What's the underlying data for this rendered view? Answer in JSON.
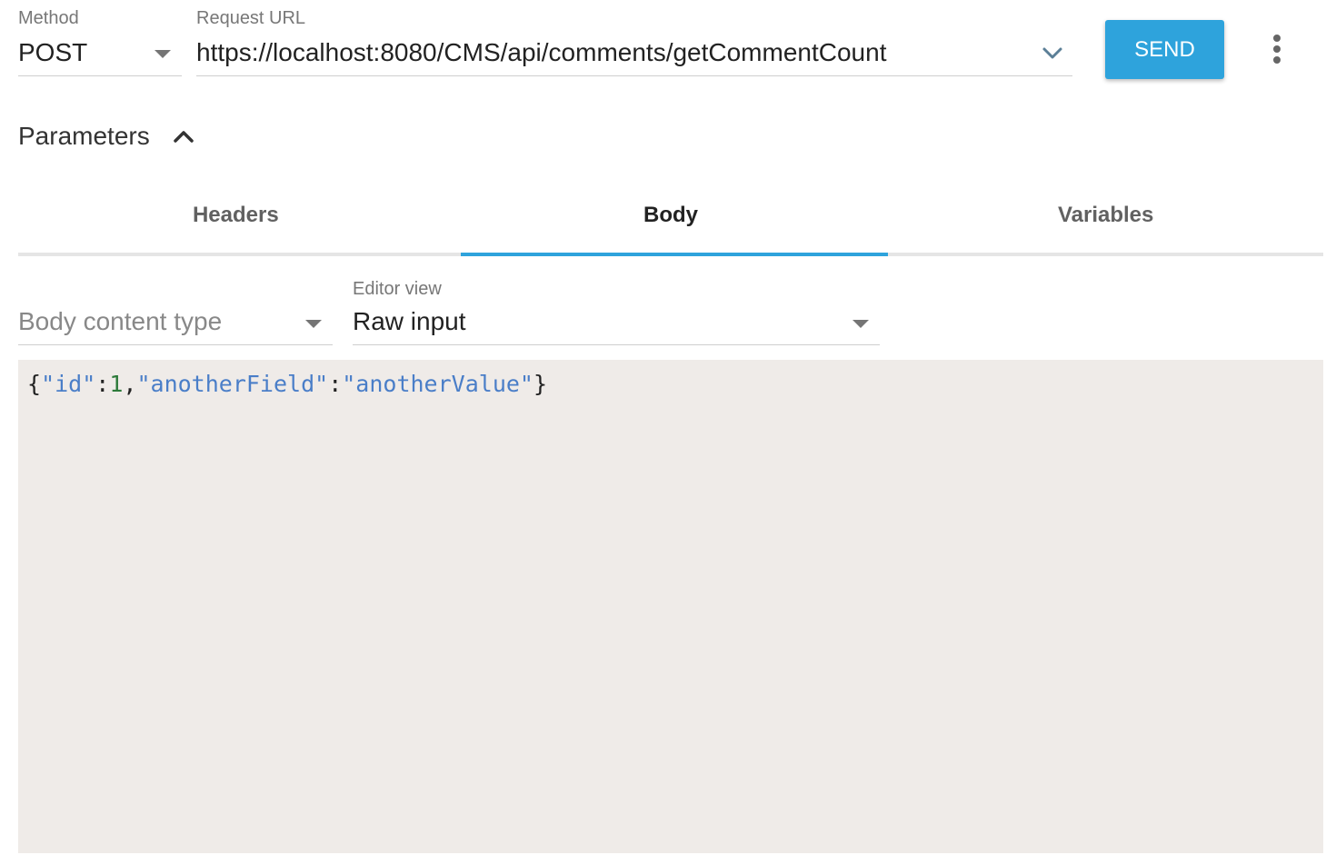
{
  "request": {
    "method_label": "Method",
    "method_value": "POST",
    "url_label": "Request URL",
    "url_value": "https://localhost:8080/CMS/api/comments/getCommentCount",
    "send_label": "SEND"
  },
  "parameters": {
    "title": "Parameters",
    "expanded": true
  },
  "tabs": [
    {
      "label": "Headers",
      "active": false
    },
    {
      "label": "Body",
      "active": true
    },
    {
      "label": "Variables",
      "active": false
    }
  ],
  "body": {
    "content_type_placeholder": "Body content type",
    "editor_view_label": "Editor view",
    "editor_view_value": "Raw input"
  },
  "editor": {
    "tokens": [
      {
        "text": "{",
        "kind": "punct"
      },
      {
        "text": "\"id\"",
        "kind": "string"
      },
      {
        "text": ":",
        "kind": "punct"
      },
      {
        "text": "1",
        "kind": "number"
      },
      {
        "text": ",",
        "kind": "punct"
      },
      {
        "text": "\"anotherField\"",
        "kind": "string"
      },
      {
        "text": ":",
        "kind": "punct"
      },
      {
        "text": "\"anotherValue\"",
        "kind": "string"
      },
      {
        "text": "}",
        "kind": "punct"
      }
    ]
  },
  "colors": {
    "accent": "#2ea3dc",
    "editor_background": "#efebe8",
    "string_token": "#4a7ec8",
    "number_token": "#2d7a3a"
  },
  "icons": {
    "method_dropdown": "caret-down-icon",
    "url_history": "chevron-down-icon",
    "more": "more-vert-icon",
    "parameters_toggle": "chevron-up-icon"
  }
}
